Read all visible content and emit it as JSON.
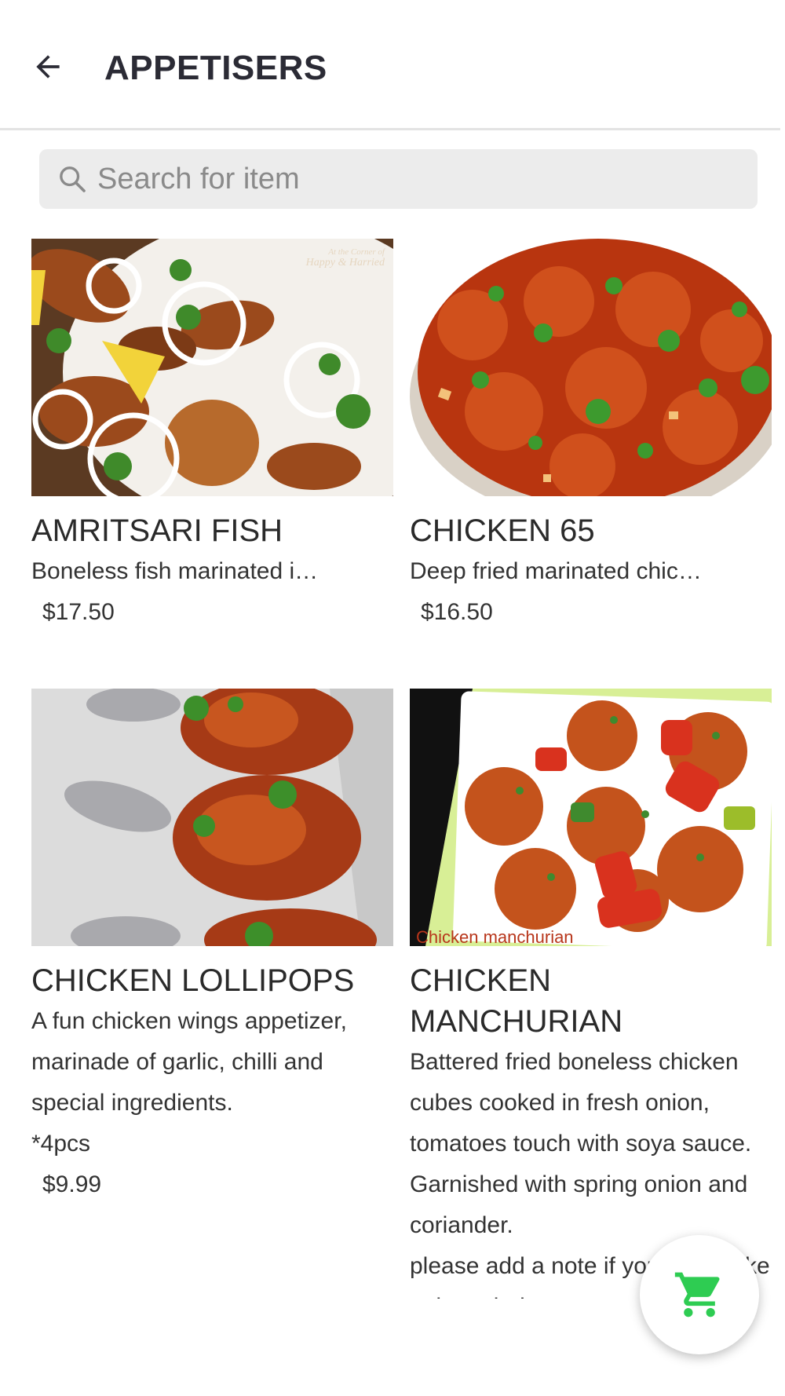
{
  "header": {
    "title": "APPETISERS",
    "back_icon": "arrow-left-icon"
  },
  "search": {
    "placeholder": "Search for item",
    "value": "",
    "icon": "search-icon"
  },
  "items": [
    {
      "name": "AMRITSARI FISH",
      "description": "Boneless fish marinated i…",
      "price": "$17.50",
      "image_watermark": "At the Corner of Happy & Harried"
    },
    {
      "name": "CHICKEN 65",
      "description": "Deep fried marinated chic…",
      "price": "$16.50"
    },
    {
      "name": "CHICKEN LOLLIPOPS",
      "description": "A fun chicken wings appetizer, marinade of garlic, chilli and special ingredients.",
      "note": "*4pcs",
      "price": "$9.99"
    },
    {
      "name": "CHICKEN MANCHURIAN",
      "description": "Battered fried boneless chicken cubes cooked in fresh onion, tomatoes touch with soya sauce. Garnished with spring onion and coriander.",
      "note": "please add a note if you would like to have it dry or",
      "image_caption": "Chicken manchurian"
    }
  ],
  "cart": {
    "icon": "shopping-cart-icon",
    "accent_color": "#2ecc52"
  }
}
